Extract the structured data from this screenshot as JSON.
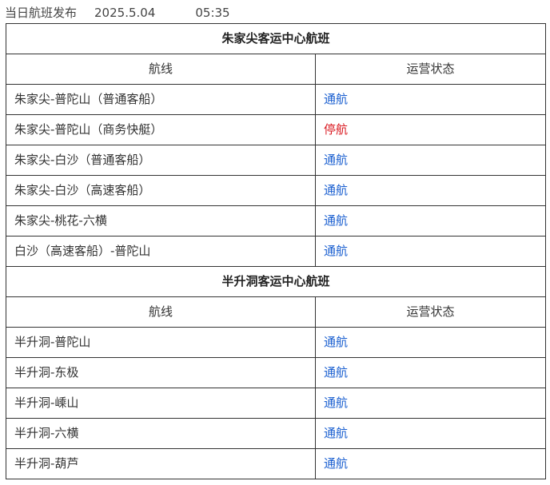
{
  "header": {
    "title": "当日航班发布",
    "date": "2025.5.04",
    "time": "05:35"
  },
  "colors": {
    "normal_status": "#1a5fd0",
    "suspended_status": "#d9181f",
    "border": "#333333"
  },
  "sections": [
    {
      "title": "朱家尖客运中心航班",
      "col_route": "航线",
      "col_status": "运营状态",
      "rows": [
        {
          "route": "朱家尖-普陀山（普通客船）",
          "status": "通航"
        },
        {
          "route": "朱家尖-普陀山（商务快艇）",
          "status": "停航"
        },
        {
          "route": "朱家尖-白沙（普通客船）",
          "status": "通航"
        },
        {
          "route": "朱家尖-白沙（高速客船）",
          "status": "通航"
        },
        {
          "route": "朱家尖-桃花-六横",
          "status": "通航"
        },
        {
          "route": "白沙（高速客船）-普陀山",
          "status": "通航"
        }
      ]
    },
    {
      "title": "半升洞客运中心航班",
      "col_route": "航线",
      "col_status": "运营状态",
      "rows": [
        {
          "route": "半升洞-普陀山",
          "status": "通航"
        },
        {
          "route": "半升洞-东极",
          "status": "通航"
        },
        {
          "route": "半升洞-嵊山",
          "status": "通航"
        },
        {
          "route": "半升洞-六横",
          "status": "通航"
        },
        {
          "route": "半升洞-葫芦",
          "status": "通航"
        }
      ]
    }
  ]
}
